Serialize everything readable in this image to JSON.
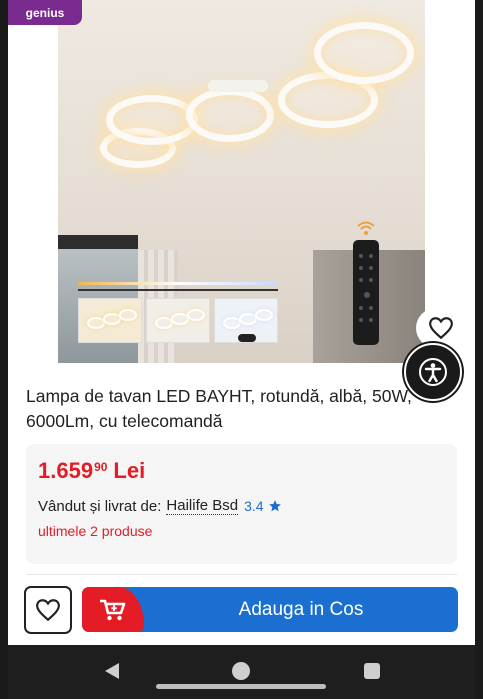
{
  "badge": {
    "label": "genius"
  },
  "product": {
    "title": "Lampa de tavan LED BAYHT, rotundă, albă, 50W, 6000Lm, cu telecomandă",
    "image_alt": "Lampa de tavan LED cu inele și telecomandă"
  },
  "pricing": {
    "integer": "1.659",
    "decimals": "90",
    "currency": "Lei"
  },
  "seller": {
    "prefix": "Vândut și livrat de:",
    "name": "Hailife Bsd",
    "rating": "3.4"
  },
  "stock": {
    "text": "ultimele 2 produse"
  },
  "actions": {
    "add_to_cart": "Adauga in Cos"
  },
  "colors": {
    "accent_red": "#e41c26",
    "accent_blue": "#1a6fd1",
    "badge_purple": "#7a2b8f"
  },
  "icons": [
    "heart-icon",
    "accessibility-icon",
    "cart-icon",
    "star-icon",
    "back-icon",
    "home-icon",
    "recent-apps-icon"
  ]
}
